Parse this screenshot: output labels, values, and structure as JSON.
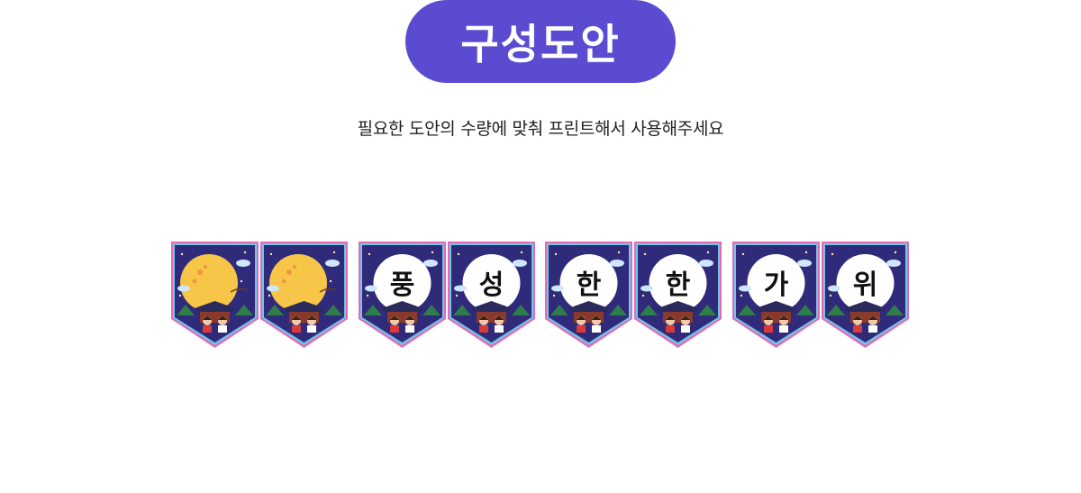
{
  "header": {
    "title": "구성도안",
    "subtitle": "필요한 도안의 수량에 맞춰 프린트해서 사용해주세요"
  },
  "colors": {
    "pill": "#5a4bd1",
    "pennant_bg": "#2f2a7a",
    "moon": "#f7c548",
    "circle": "#ffffff",
    "border_pink": "#e46ab5",
    "border_blue": "#6fc6e6"
  },
  "pennants": [
    {
      "kind": "moon",
      "char": ""
    },
    {
      "kind": "moon",
      "char": ""
    },
    {
      "kind": "letter",
      "char": "풍"
    },
    {
      "kind": "letter",
      "char": "성"
    },
    {
      "kind": "letter",
      "char": "한"
    },
    {
      "kind": "letter",
      "char": "한"
    },
    {
      "kind": "letter",
      "char": "가"
    },
    {
      "kind": "letter",
      "char": "위"
    }
  ]
}
